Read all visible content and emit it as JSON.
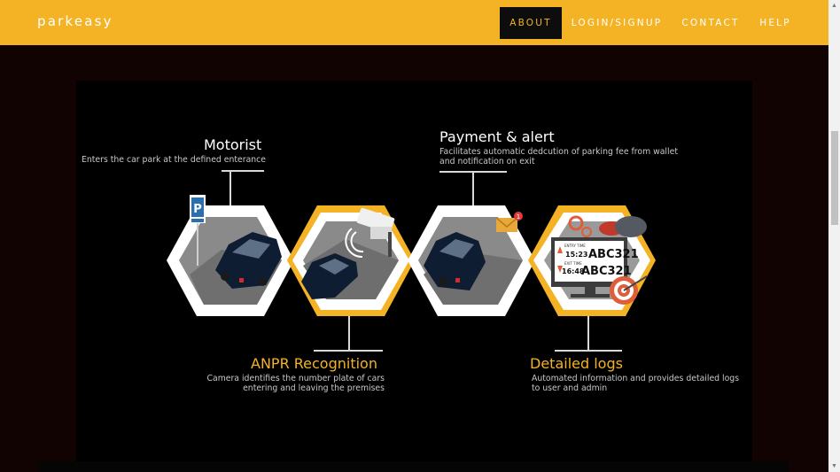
{
  "brand": "parkeasy",
  "nav": {
    "about": "ABOUT",
    "login": "LOGIN/SIGNUP",
    "contact": "CONTACT",
    "help": "HELP"
  },
  "colors": {
    "navbar": "#f4b324",
    "accent": "#f4b324",
    "background": "#120303",
    "panel": "#000000"
  },
  "steps": {
    "motorist": {
      "title": "Motorist",
      "desc": "Enters the car park at the defined enterance"
    },
    "payment": {
      "title": "Payment & alert",
      "desc": "Facilitates automatic dedcution of parking fee from wallet\nand notification on exit"
    },
    "anpr": {
      "title": "ANPR Recognition",
      "desc": "Camera identifies the number plate of cars\nentering and leaving the premises"
    },
    "logs": {
      "title": "Detailed logs",
      "desc": "Automated information and provides detailed logs\nto user and admin"
    }
  },
  "illustration": {
    "parking_sign": "P",
    "notification_count": "1",
    "monitor": {
      "entry_label": "ENTRY TIME",
      "entry_time": "15:23",
      "exit_label": "EXIT TIME",
      "exit_time": "16:48",
      "plate": "ABC321"
    }
  }
}
